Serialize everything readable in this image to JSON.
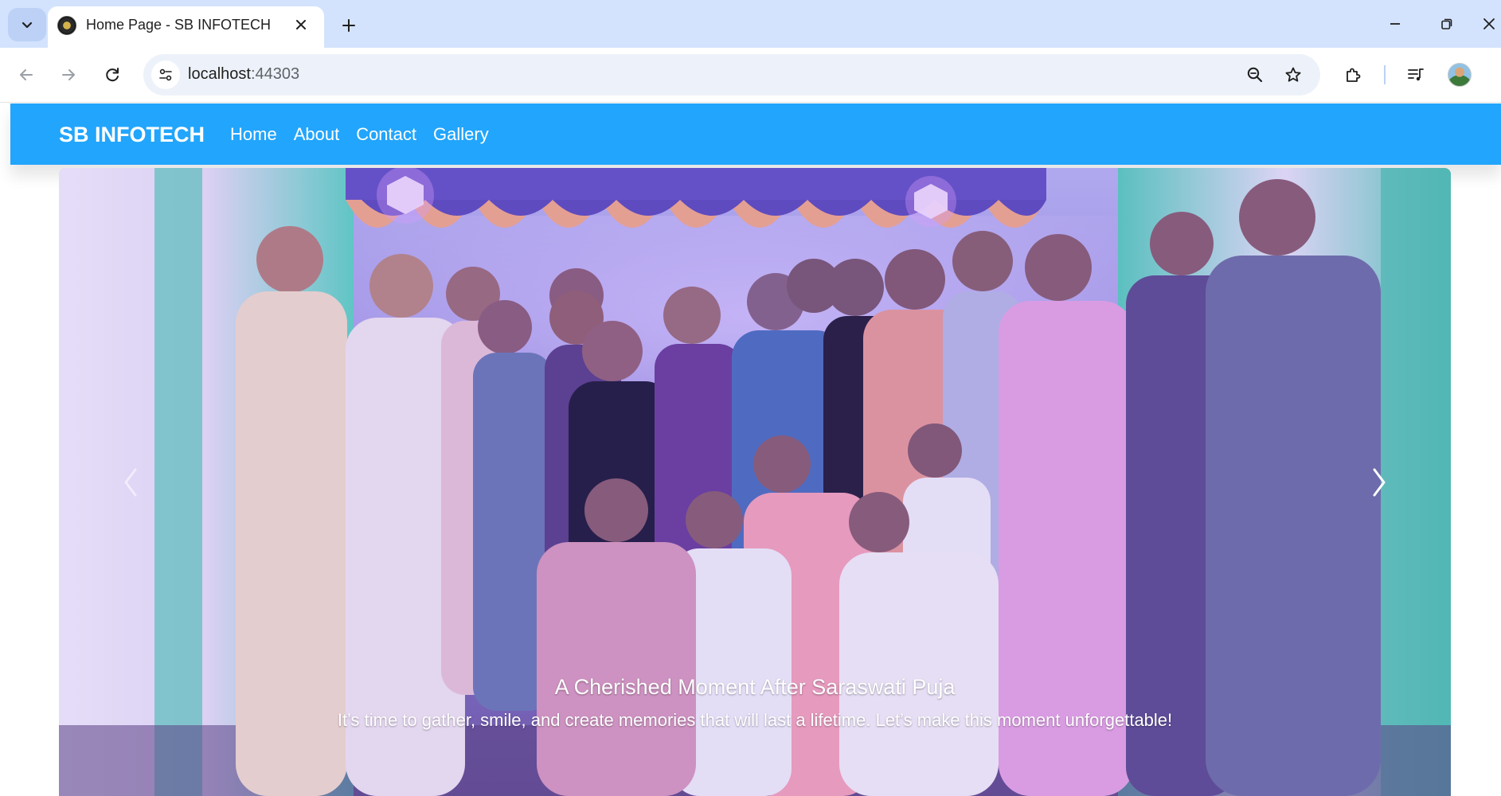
{
  "browser": {
    "tab_title": "Home Page - SB INFOTECH",
    "url_host": "localhost",
    "url_port": ":44303",
    "icons": {
      "tab_search": "chevron-down-icon",
      "tab_close": "close-icon",
      "new_tab": "plus-icon",
      "minimize": "minimize-icon",
      "restore": "restore-icon",
      "close_window": "close-icon",
      "back": "arrow-left-icon",
      "forward": "arrow-right-icon",
      "reload": "reload-icon",
      "site_info": "tune-icon",
      "zoom": "zoom-out-icon",
      "bookmark": "star-icon",
      "extensions": "puzzle-icon",
      "media": "queue-music-icon"
    }
  },
  "navbar": {
    "brand": "SB INFOTECH",
    "links": [
      "Home",
      "About",
      "Contact",
      "Gallery"
    ],
    "color": "#22a5fc"
  },
  "carousel": {
    "caption_title": "A Cherished Moment After Saraswati Puja",
    "caption_text": "It’s time to gather, smile, and create memories that will last a lifetime. Let’s make this moment unforgettable!",
    "icons": {
      "prev": "chevron-left-icon",
      "next": "chevron-right-icon"
    }
  }
}
